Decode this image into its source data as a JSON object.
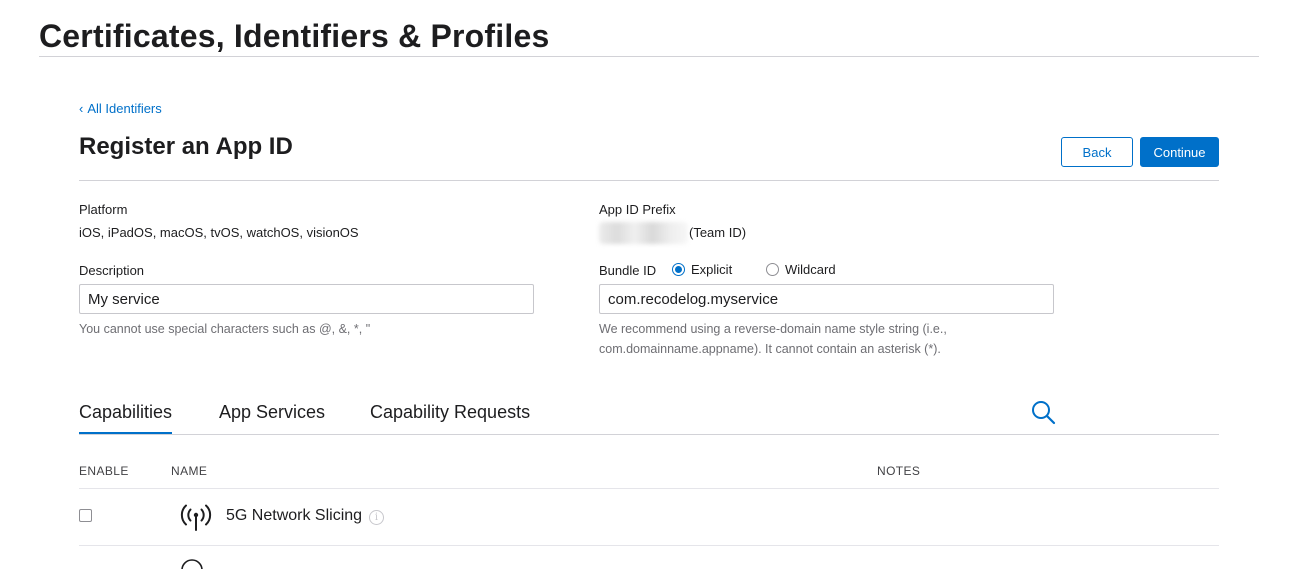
{
  "page": {
    "title": "Certificates, Identifiers & Profiles"
  },
  "nav": {
    "back_chevron": "‹",
    "back_label": "All Identifiers"
  },
  "form": {
    "title": "Register an App ID",
    "back_button": "Back",
    "continue_button": "Continue",
    "platform_label": "Platform",
    "platform_value": "iOS, iPadOS, macOS, tvOS, watchOS, visionOS",
    "prefix_label": "App ID Prefix",
    "prefix_suffix": "(Team ID)",
    "description_label": "Description",
    "description_value": "My service",
    "description_hint": "You cannot use special characters such as @, &, *, \"",
    "bundle_label": "Bundle ID",
    "bundle_explicit": "Explicit",
    "bundle_wildcard": "Wildcard",
    "bundle_selected": "Explicit",
    "bundle_value": "com.recodelog.myservice",
    "bundle_hint_1": "We recommend using a reverse-domain name style string (i.e.,",
    "bundle_hint_2": "com.domainname.appname). It cannot contain an asterisk (*)."
  },
  "tabs": [
    {
      "label": "Capabilities",
      "active": true
    },
    {
      "label": "App Services",
      "active": false
    },
    {
      "label": "Capability Requests",
      "active": false
    }
  ],
  "table": {
    "headers": {
      "enable": "ENABLE",
      "name": "NAME",
      "notes": "NOTES"
    },
    "rows": [
      {
        "name": "5G Network Slicing",
        "icon": "antenna-icon",
        "enabled": false,
        "notes": ""
      }
    ]
  },
  "colors": {
    "accent": "#0070c9",
    "text": "#1d1d1f",
    "muted": "#6e6e73",
    "border": "#d2d2d7"
  }
}
